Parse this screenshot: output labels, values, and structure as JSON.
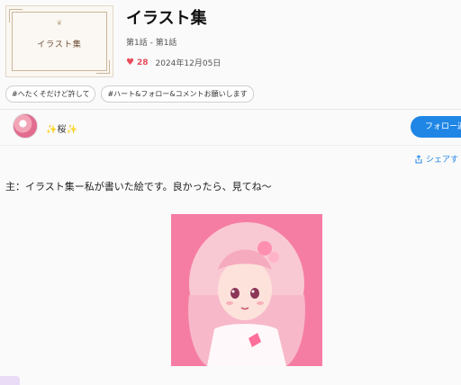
{
  "cover": {
    "text": "イラスト集"
  },
  "work": {
    "title": "イラスト集",
    "episode": "第1話 - 第1話",
    "likes": "28",
    "date": "2024年12月05日"
  },
  "tags": [
    "#へたくそだけど許して",
    "#ハート&フォロー&コメントお願いします"
  ],
  "author": {
    "name": "✨桜✨"
  },
  "follow": {
    "label": "フォロー返"
  },
  "share": {
    "label": "シェアす"
  },
  "description": "主：イラスト集ー私が書いた絵です。良かったら、見てね〜",
  "colors": {
    "accent": "#1f86e6",
    "heart": "#e94b5a",
    "art_bg": "#f57da3"
  }
}
